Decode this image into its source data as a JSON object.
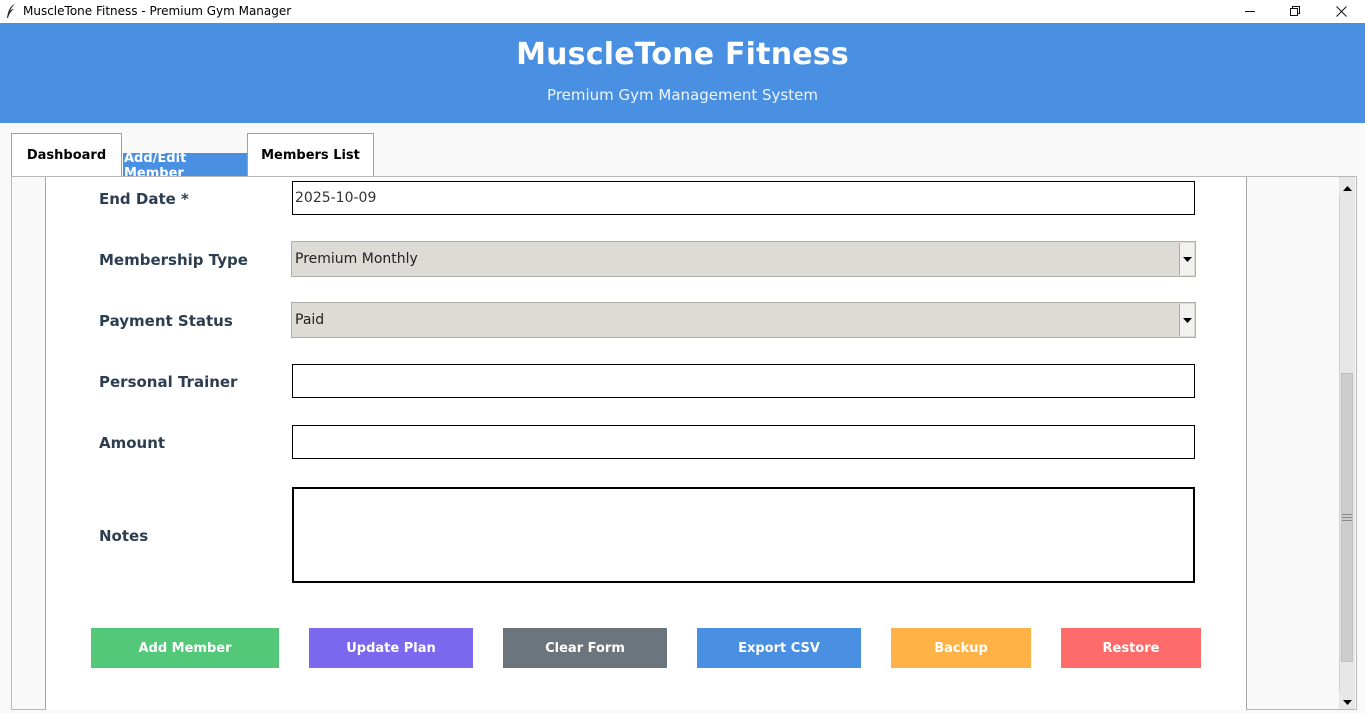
{
  "window": {
    "title": "MuscleTone Fitness - Premium Gym Manager"
  },
  "header": {
    "title": "MuscleTone Fitness",
    "subtitle": "Premium Gym Management System",
    "bg_color": "#4a90e2"
  },
  "tabs": [
    {
      "label": "Dashboard",
      "active": false
    },
    {
      "label": "Add/Edit Member",
      "active": true
    },
    {
      "label": "Members List",
      "active": false
    }
  ],
  "form": {
    "end_date": {
      "label": "End Date *",
      "value": "2025-10-09"
    },
    "membership_type": {
      "label": "Membership Type",
      "value": "Premium Monthly"
    },
    "payment_status": {
      "label": "Payment Status",
      "value": "Paid"
    },
    "personal_trainer": {
      "label": "Personal Trainer",
      "value": ""
    },
    "amount": {
      "label": "Amount",
      "value": ""
    },
    "notes": {
      "label": "Notes",
      "value": ""
    }
  },
  "buttons": {
    "add": {
      "label": "Add Member",
      "color": "#52c878"
    },
    "update": {
      "label": "Update Plan",
      "color": "#7b68ee"
    },
    "clear": {
      "label": "Clear Form",
      "color": "#6c757d"
    },
    "export": {
      "label": "Export CSV",
      "color": "#4a90e2"
    },
    "backup": {
      "label": "Backup",
      "color": "#ffb347"
    },
    "restore": {
      "label": "Restore",
      "color": "#ff6b6b"
    }
  },
  "icons": {
    "app": "feather-icon",
    "minimize": "minimize-icon",
    "maximize": "restore-window-icon",
    "close": "close-icon"
  }
}
